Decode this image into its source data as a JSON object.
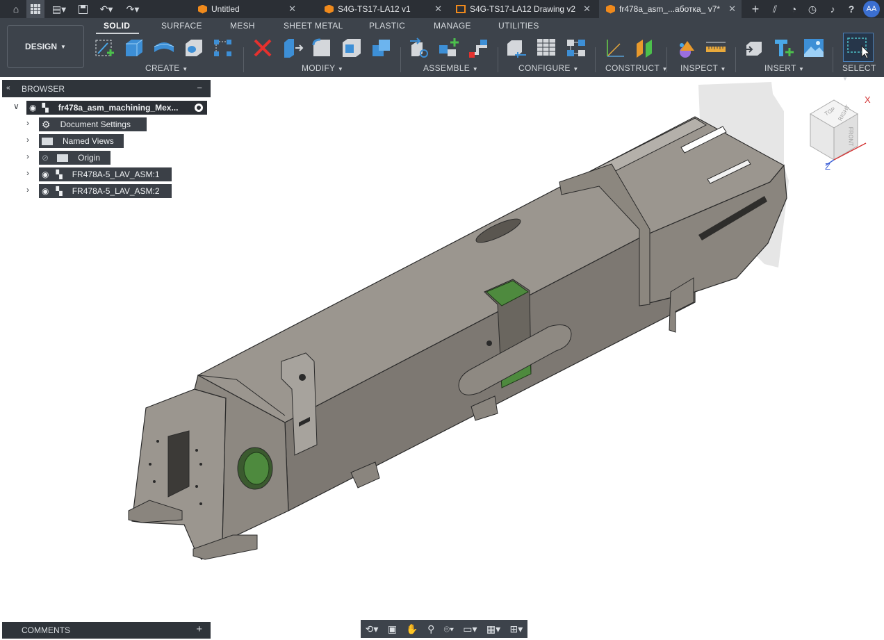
{
  "tabs": [
    {
      "label": "Untitled",
      "kind": "model"
    },
    {
      "label": "S4G-TS17-LA12 v1",
      "kind": "model"
    },
    {
      "label": "S4G-TS17-LA12 Drawing v2",
      "kind": "drawing"
    },
    {
      "label": "fr478a_asm_...аботка_ v7*",
      "kind": "model",
      "active": true
    }
  ],
  "user_initials": "AA",
  "workspace": "DESIGN",
  "ribbon_tabs": [
    "SOLID",
    "SURFACE",
    "MESH",
    "SHEET METAL",
    "PLASTIC",
    "MANAGE",
    "UTILITIES"
  ],
  "ribbon_groups": [
    "CREATE",
    "MODIFY",
    "ASSEMBLE",
    "CONFIGURE",
    "CONSTRUCT",
    "INSPECT",
    "INSERT",
    "SELECT"
  ],
  "browser": {
    "title": "BROWSER",
    "root": "fr478a_asm_machining_Mex...",
    "items": [
      {
        "label": "Document Settings",
        "icon": "gear-icon"
      },
      {
        "label": "Named Views",
        "icon": "folder-icon"
      },
      {
        "label": "Origin",
        "icon": "folder-icon"
      },
      {
        "label": "FR478A-5_LAV_ASM:1",
        "icon": "component-icon"
      },
      {
        "label": "FR478A-5_LAV_ASM:2",
        "icon": "component-icon"
      }
    ]
  },
  "comments": {
    "title": "COMMENTS"
  },
  "viewcube": {
    "faces": [
      "TOP",
      "FRONT",
      "RIGHT"
    ],
    "axes": [
      "X",
      "Z"
    ]
  },
  "colors": {
    "chrome_dark": "#2b2f35",
    "ribbon": "#3d434b",
    "model_body": "#8a857e",
    "model_highlight": "#4e8a3e",
    "accent_orange": "#f08a1c"
  }
}
